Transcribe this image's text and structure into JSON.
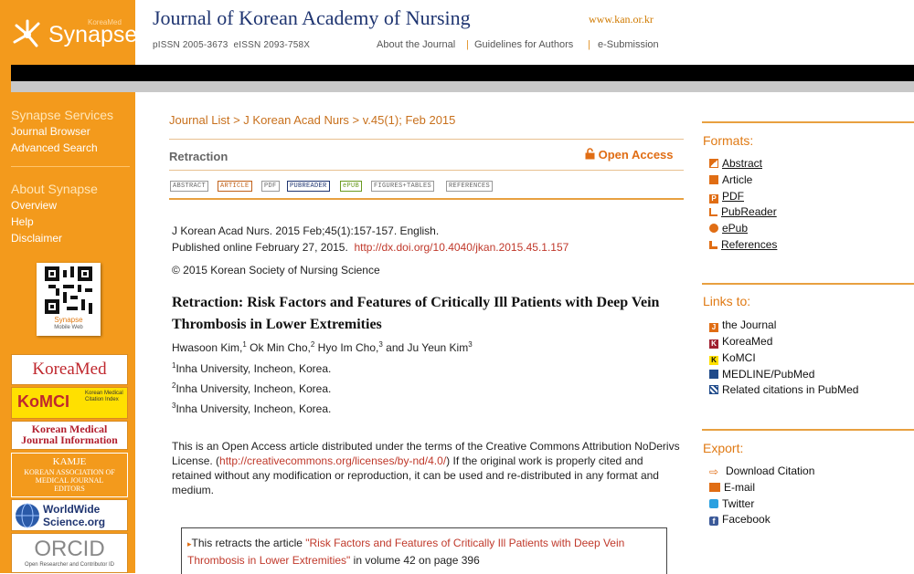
{
  "sidebar": {
    "logo": {
      "name": "Synapse",
      "tag": "KoreaMed"
    },
    "services_heading": "Synapse Services",
    "services": [
      "Journal Browser",
      "Advanced Search"
    ],
    "about_heading": "About Synapse",
    "about": [
      "Overview",
      "Help",
      "Disclaimer"
    ],
    "qr_label": "Synapse",
    "qr_sub": "Mobile Web",
    "banners": {
      "koreamed": "KoreaMed",
      "komci": "KoMCI",
      "komci_sub": "Korean Medical Citation Index",
      "kmji": "Korean Medical Journal Information",
      "kamje": "KAMJE",
      "kamje_sub": "KOREAN ASSOCIATION OF MEDICAL JOURNAL EDITORS",
      "worldwide": "WorldWide Science.org",
      "orcid": "ORCID",
      "orcid_sub": "Open Researcher and Contributor ID"
    }
  },
  "header": {
    "title": "Journal of Korean Academy of Nursing",
    "url": "www.kan.or.kr",
    "pissn": "pISSN 2005-3673",
    "eissn": "eISSN 2093-758X",
    "nav": [
      "About the Journal",
      "Guidelines for Authors",
      "e-Submission"
    ]
  },
  "main": {
    "breadcrumb": "Journal List > J Korean Acad Nurs > v.45(1); Feb 2015",
    "section": "Retraction",
    "open_access": "Open Access",
    "format_buttons": [
      "ABSTRACT",
      "ARTICLE",
      "PDF",
      "PUBREADER",
      "ePUB",
      "FIGURES+TABLES",
      "REFERENCES"
    ],
    "citation": "J Korean Acad Nurs. 2015 Feb;45(1):157-157. English.",
    "published": "Published online February 27, 2015.",
    "doi": "http://dx.doi.org/10.4040/jkan.2015.45.1.157",
    "copyright": "© 2015 Korean Society of Nursing Science",
    "article_title": "Retraction: Risk Factors and Features of Critically Ill Patients with Deep Vein Thrombosis in Lower Extremities",
    "authors": [
      {
        "name": "Hwasoon Kim,",
        "sup": "1"
      },
      {
        "name": "Ok Min Cho,",
        "sup": "2"
      },
      {
        "name": "Hyo Im Cho,",
        "sup": "3"
      },
      {
        "name": "and Ju Yeun Kim",
        "sup": "3"
      }
    ],
    "affiliations": [
      {
        "sup": "1",
        "text": "Inha University, Incheon, Korea."
      },
      {
        "sup": "2",
        "text": "Inha University, Incheon, Korea."
      },
      {
        "sup": "3",
        "text": "Inha University, Incheon, Korea."
      }
    ],
    "license_pre": "This is an Open Access article distributed under the terms of the Creative Commons Attribution NoDerivs License. (",
    "license_url": "http://creativecommons.org/licenses/by-nd/4.0/",
    "license_post": ") If the original work is properly cited and retained without any modification or reproduction, it can be used and re-distributed in any format and medium.",
    "retract_pre": "This retracts the article ",
    "retract_link": "\"Risk Factors and Features of Critically Ill Patients with Deep Vein Thrombosis in Lower Extremities\"",
    "retract_post": " in volume 42 on page 396"
  },
  "right": {
    "formats_heading": "Formats:",
    "formats": [
      "Abstract",
      "Article",
      "PDF",
      "PubReader",
      "ePub",
      "References"
    ],
    "links_heading": "Links to:",
    "links": [
      "the Journal",
      "KoreaMed",
      "KoMCI",
      "MEDLINE/PubMed",
      "Related citations in PubMed"
    ],
    "export_heading": "Export:",
    "export": [
      "Download Citation",
      "E-mail",
      "Twitter",
      "Facebook"
    ]
  },
  "colors": {
    "accent": "#f39a1c",
    "title_blue": "#1f3571",
    "link_red": "#c0392b"
  }
}
